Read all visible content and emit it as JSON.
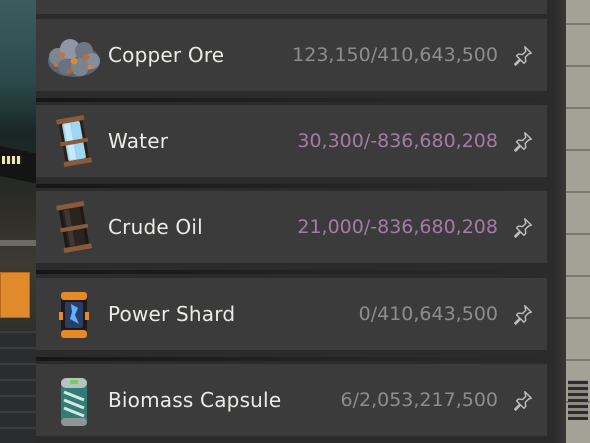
{
  "inventory": {
    "items": [
      {
        "name": "Copper Ore",
        "amount": "123,150/410,643,500",
        "amount_state": "normal",
        "icon": "copper-ore-icon"
      },
      {
        "name": "Water",
        "amount": "30,300/-836,680,208",
        "amount_state": "overflow",
        "icon": "packaged-water-icon"
      },
      {
        "name": "Crude Oil",
        "amount": "21,000/-836,680,208",
        "amount_state": "overflow",
        "icon": "packaged-oil-icon"
      },
      {
        "name": "Power Shard",
        "amount": "0/410,643,500",
        "amount_state": "normal",
        "icon": "power-shard-icon"
      },
      {
        "name": "Biomass Capsule",
        "amount": "6/2,053,217,500",
        "amount_state": "normal",
        "icon": "biomass-capsule-icon"
      }
    ],
    "pin_icon": "pin-icon"
  },
  "colors": {
    "row_background": "#3b3b3b",
    "panel_background": "#2b2b2b",
    "name_text": "#ecebe7",
    "amount_normal": "#8d8d8d",
    "amount_overflow": "#a57aa6",
    "pin": "#bdbdbd"
  }
}
